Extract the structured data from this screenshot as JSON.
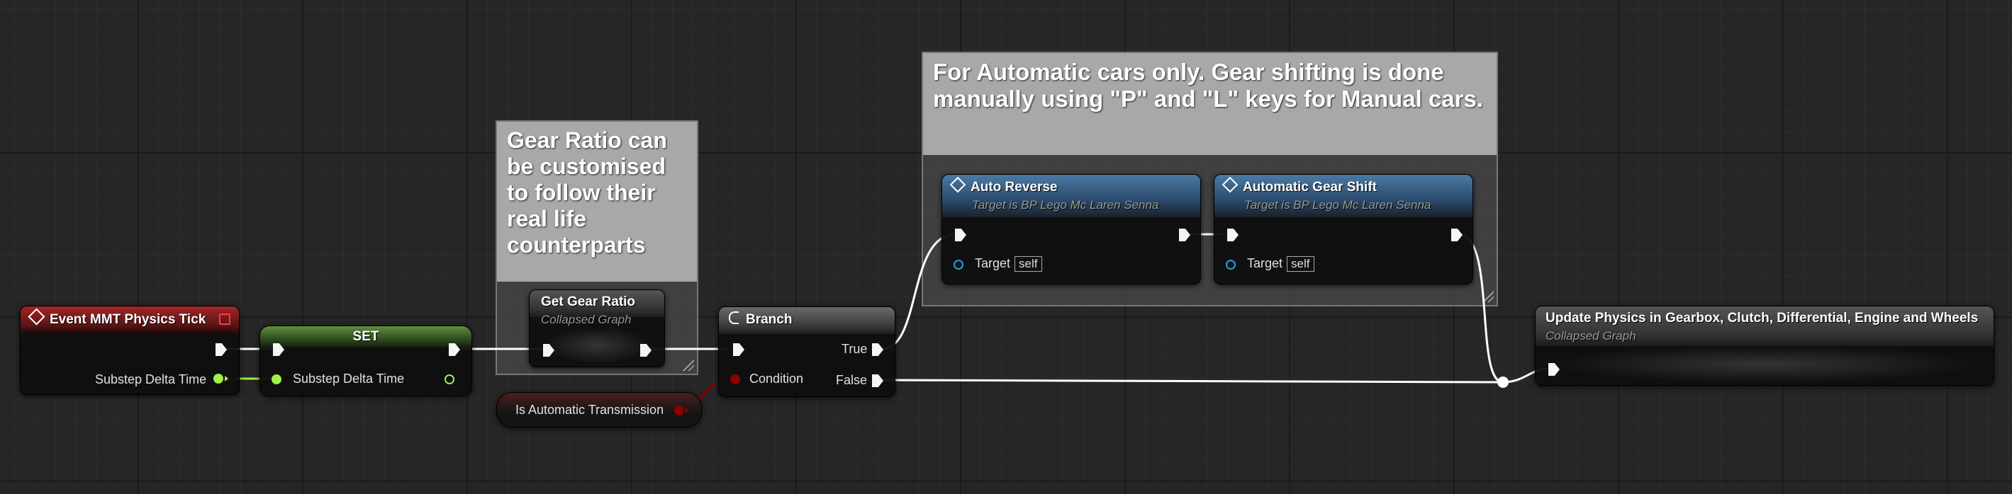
{
  "comments": {
    "gear_ratio": "Gear Ratio can be customised to follow their real life counterparts",
    "automatic": "For Automatic cars only. Gear shifting is done manually using \"P\" and \"L\" keys for Manual cars."
  },
  "nodes": {
    "event_tick": {
      "title": "Event MMT Physics Tick",
      "out_pin": "Substep Delta Time"
    },
    "set_node": {
      "title": "SET",
      "in_pin": "Substep Delta Time"
    },
    "get_gear_ratio": {
      "title": "Get Gear Ratio",
      "subtitle": "Collapsed Graph"
    },
    "is_automatic": {
      "title": "Is Automatic Transmission"
    },
    "branch": {
      "title": "Branch",
      "true_label": "True",
      "false_label": "False",
      "condition_label": "Condition"
    },
    "auto_reverse": {
      "title": "Auto Reverse",
      "subtitle": "Target is BP Lego Mc Laren Senna",
      "target_label": "Target",
      "target_value": "self"
    },
    "auto_gear_shift": {
      "title": "Automatic Gear Shift",
      "subtitle": "Target is BP Lego Mc Laren Senna",
      "target_label": "Target",
      "target_value": "self"
    },
    "update_physics": {
      "title": "Update Physics in Gearbox, Clutch, Differential, Engine and Wheels",
      "subtitle": "Collapsed Graph"
    }
  },
  "colors": {
    "event_header": "#8a1f1f",
    "function_header": "#35638a",
    "exec_wire": "#ffffff",
    "float_pin": "#9ef04b",
    "bool_pin": "#8c0000",
    "object_pin": "#2aa0e0"
  },
  "icons": {
    "event": "diamond-icon",
    "function": "function-diamond-icon",
    "branch": "branch-icon",
    "delegate": "red-square-icon"
  }
}
